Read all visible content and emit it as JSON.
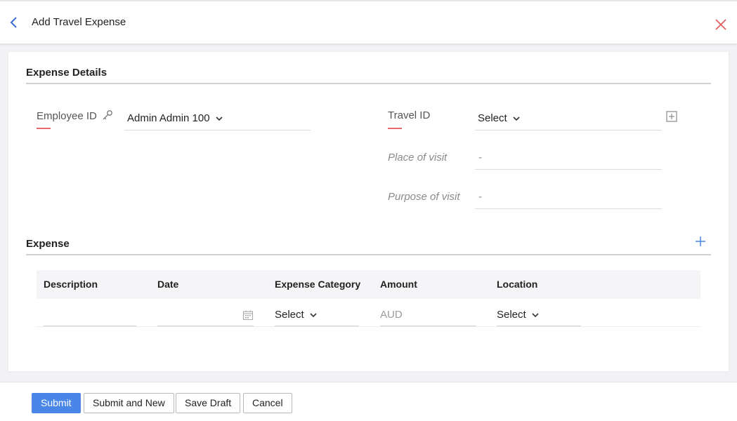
{
  "header": {
    "title": "Add Travel Expense"
  },
  "expense_details": {
    "section_title": "Expense Details",
    "employee_id": {
      "label": "Employee ID",
      "value": "Admin Admin 100"
    },
    "travel_id": {
      "label": "Travel ID",
      "value": "Select"
    },
    "place_of_visit": {
      "label": "Place of visit",
      "value": "-"
    },
    "purpose_of_visit": {
      "label": "Purpose of visit",
      "value": "-"
    }
  },
  "expense": {
    "section_title": "Expense",
    "columns": [
      "Description",
      "Date",
      "Expense Category",
      "Amount",
      "Location"
    ],
    "row": {
      "description": "",
      "date": "",
      "category": "Select",
      "amount_placeholder": "AUD",
      "location": "Select"
    }
  },
  "footer": {
    "submit": "Submit",
    "submit_and_new": "Submit and New",
    "save_draft": "Save Draft",
    "cancel": "Cancel"
  },
  "colors": {
    "accent": "#4a86e8",
    "required_mark": "#e8676f",
    "close": "#e05a5a"
  },
  "icons": [
    "back-arrow-icon",
    "close-icon",
    "key-icon",
    "chevron-down-icon",
    "add-square-icon",
    "plus-icon",
    "calendar-icon"
  ]
}
